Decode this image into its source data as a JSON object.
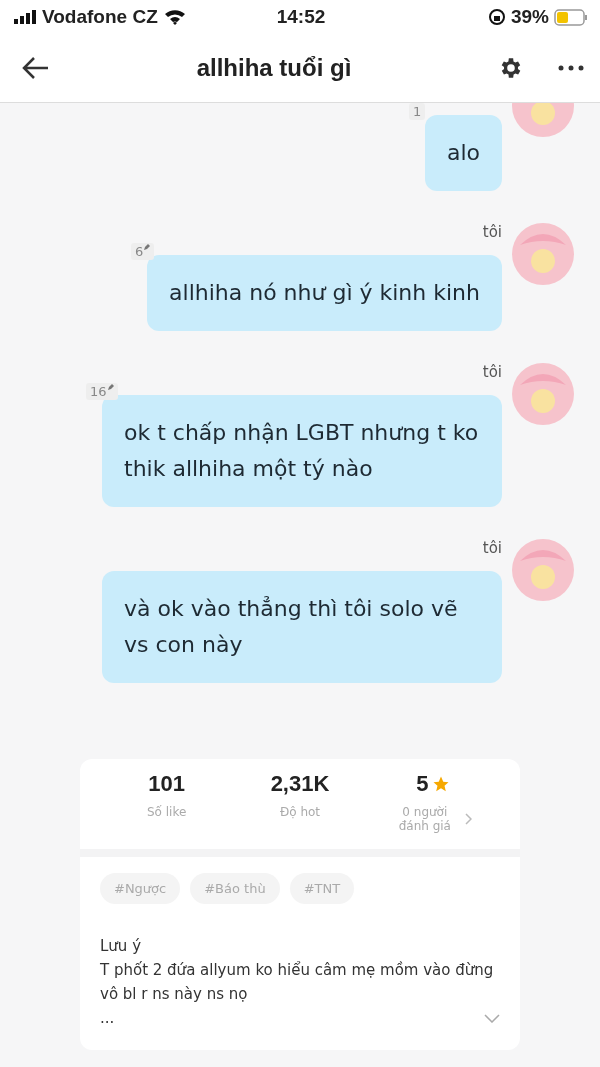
{
  "status_bar": {
    "carrier": "Vodafone CZ",
    "time": "14:52",
    "battery": "39%"
  },
  "header": {
    "title": "allhiha tuổi gì"
  },
  "messages": [
    {
      "text": "alo",
      "count": "1",
      "edited": false
    },
    {
      "sender": "tôi",
      "text": "allhiha nó như gì ý kinh kinh",
      "count": "6",
      "edited": true
    },
    {
      "sender": "tôi",
      "text": "ok t chấp nhận LGBT nhưng t ko thik allhiha một tý nào",
      "count": "16",
      "edited": true
    },
    {
      "sender": "tôi",
      "text": "và ok vào thẳng thì tôi solo vẽ vs con này"
    }
  ],
  "stats": [
    {
      "value": "101",
      "label": "Số like",
      "kind": "plain"
    },
    {
      "value": "2,31K",
      "label": "Độ hot",
      "kind": "plain"
    },
    {
      "value": "5",
      "label": "0 người đánh giá",
      "kind": "rating"
    }
  ],
  "tags": [
    "#Ngược",
    "#Báo thù",
    "#TNT"
  ],
  "note_lines": [
    "Lưu ý",
    "T phốt 2 đứa allyum ko hiểu câm mẹ mồm vào đừng vô bl r ns này ns nọ",
    "..."
  ]
}
